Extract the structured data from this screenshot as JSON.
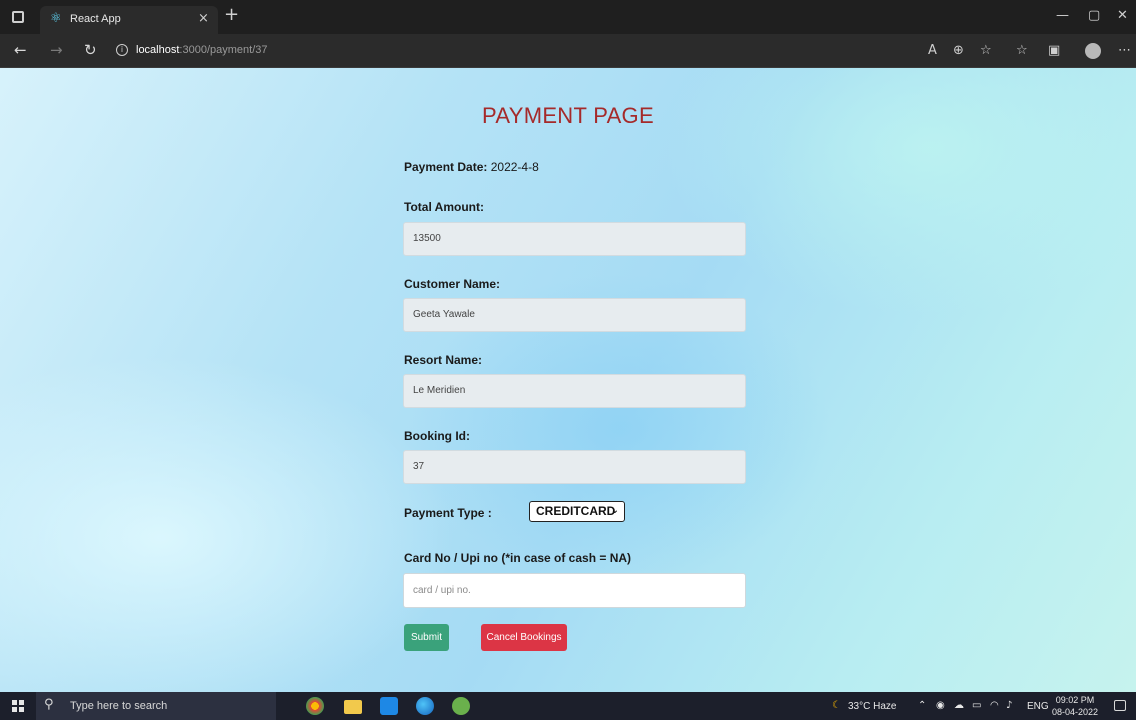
{
  "browser": {
    "tab_title": "React App",
    "tab_close": "×",
    "new_tab": "+",
    "url_host": "localhost",
    "url_path": ":3000/payment/37",
    "window_controls": {
      "minimize": "—",
      "maximize": "▢",
      "close": "✕"
    }
  },
  "page": {
    "title": "PAYMENT PAGE",
    "payment_date": {
      "label": "Payment Date:",
      "value": "2022-4-8"
    },
    "total_amount": {
      "label": "Total Amount:",
      "value": "13500"
    },
    "customer_name": {
      "label": "Customer Name:",
      "value": "Geeta Yawale"
    },
    "resort_name": {
      "label": "Resort Name:",
      "value": "Le Meridien"
    },
    "booking_id": {
      "label": "Booking Id:",
      "value": "37"
    },
    "payment_type": {
      "label": "Payment Type :",
      "selected": "CREDITCARD"
    },
    "card_no": {
      "label": "Card No / Upi no (*in case of cash = NA)",
      "placeholder": "card / upi no."
    },
    "buttons": {
      "submit": "Submit",
      "cancel": "Cancel Bookings"
    },
    "colors": {
      "title": "#a52a2a",
      "submit": "#3aa27b",
      "cancel": "#dc3545"
    }
  },
  "taskbar": {
    "search_placeholder": "Type here to search",
    "weather": "33°C  Haze",
    "language": "ENG",
    "time": "09:02 PM",
    "date": "08-04-2022"
  }
}
